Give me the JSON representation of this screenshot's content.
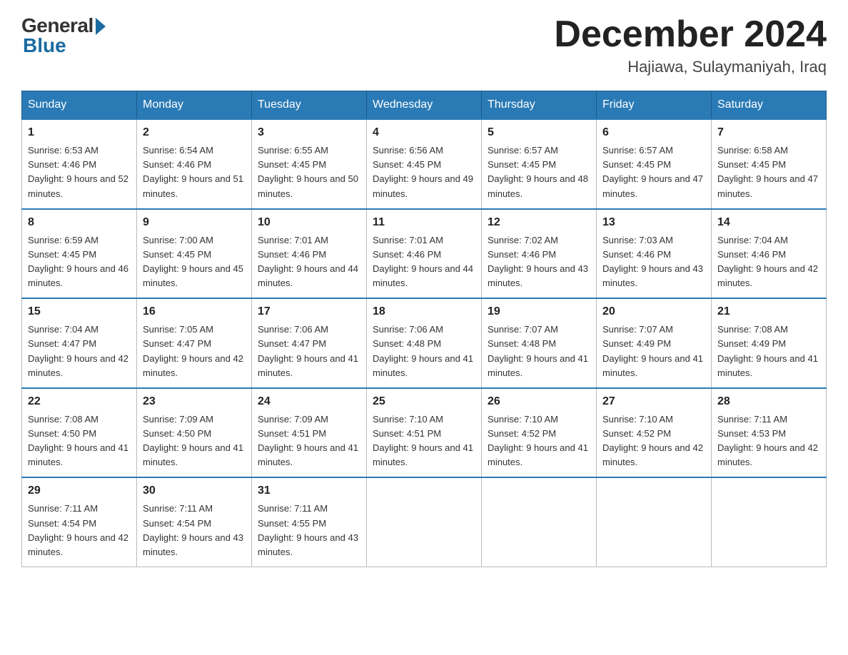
{
  "header": {
    "logo_general": "General",
    "logo_blue": "Blue",
    "month_title": "December 2024",
    "location": "Hajiawa, Sulaymaniyah, Iraq"
  },
  "days_of_week": [
    "Sunday",
    "Monday",
    "Tuesday",
    "Wednesday",
    "Thursday",
    "Friday",
    "Saturday"
  ],
  "weeks": [
    [
      {
        "num": "1",
        "sunrise": "Sunrise: 6:53 AM",
        "sunset": "Sunset: 4:46 PM",
        "daylight": "Daylight: 9 hours and 52 minutes."
      },
      {
        "num": "2",
        "sunrise": "Sunrise: 6:54 AM",
        "sunset": "Sunset: 4:46 PM",
        "daylight": "Daylight: 9 hours and 51 minutes."
      },
      {
        "num": "3",
        "sunrise": "Sunrise: 6:55 AM",
        "sunset": "Sunset: 4:45 PM",
        "daylight": "Daylight: 9 hours and 50 minutes."
      },
      {
        "num": "4",
        "sunrise": "Sunrise: 6:56 AM",
        "sunset": "Sunset: 4:45 PM",
        "daylight": "Daylight: 9 hours and 49 minutes."
      },
      {
        "num": "5",
        "sunrise": "Sunrise: 6:57 AM",
        "sunset": "Sunset: 4:45 PM",
        "daylight": "Daylight: 9 hours and 48 minutes."
      },
      {
        "num": "6",
        "sunrise": "Sunrise: 6:57 AM",
        "sunset": "Sunset: 4:45 PM",
        "daylight": "Daylight: 9 hours and 47 minutes."
      },
      {
        "num": "7",
        "sunrise": "Sunrise: 6:58 AM",
        "sunset": "Sunset: 4:45 PM",
        "daylight": "Daylight: 9 hours and 47 minutes."
      }
    ],
    [
      {
        "num": "8",
        "sunrise": "Sunrise: 6:59 AM",
        "sunset": "Sunset: 4:45 PM",
        "daylight": "Daylight: 9 hours and 46 minutes."
      },
      {
        "num": "9",
        "sunrise": "Sunrise: 7:00 AM",
        "sunset": "Sunset: 4:45 PM",
        "daylight": "Daylight: 9 hours and 45 minutes."
      },
      {
        "num": "10",
        "sunrise": "Sunrise: 7:01 AM",
        "sunset": "Sunset: 4:46 PM",
        "daylight": "Daylight: 9 hours and 44 minutes."
      },
      {
        "num": "11",
        "sunrise": "Sunrise: 7:01 AM",
        "sunset": "Sunset: 4:46 PM",
        "daylight": "Daylight: 9 hours and 44 minutes."
      },
      {
        "num": "12",
        "sunrise": "Sunrise: 7:02 AM",
        "sunset": "Sunset: 4:46 PM",
        "daylight": "Daylight: 9 hours and 43 minutes."
      },
      {
        "num": "13",
        "sunrise": "Sunrise: 7:03 AM",
        "sunset": "Sunset: 4:46 PM",
        "daylight": "Daylight: 9 hours and 43 minutes."
      },
      {
        "num": "14",
        "sunrise": "Sunrise: 7:04 AM",
        "sunset": "Sunset: 4:46 PM",
        "daylight": "Daylight: 9 hours and 42 minutes."
      }
    ],
    [
      {
        "num": "15",
        "sunrise": "Sunrise: 7:04 AM",
        "sunset": "Sunset: 4:47 PM",
        "daylight": "Daylight: 9 hours and 42 minutes."
      },
      {
        "num": "16",
        "sunrise": "Sunrise: 7:05 AM",
        "sunset": "Sunset: 4:47 PM",
        "daylight": "Daylight: 9 hours and 42 minutes."
      },
      {
        "num": "17",
        "sunrise": "Sunrise: 7:06 AM",
        "sunset": "Sunset: 4:47 PM",
        "daylight": "Daylight: 9 hours and 41 minutes."
      },
      {
        "num": "18",
        "sunrise": "Sunrise: 7:06 AM",
        "sunset": "Sunset: 4:48 PM",
        "daylight": "Daylight: 9 hours and 41 minutes."
      },
      {
        "num": "19",
        "sunrise": "Sunrise: 7:07 AM",
        "sunset": "Sunset: 4:48 PM",
        "daylight": "Daylight: 9 hours and 41 minutes."
      },
      {
        "num": "20",
        "sunrise": "Sunrise: 7:07 AM",
        "sunset": "Sunset: 4:49 PM",
        "daylight": "Daylight: 9 hours and 41 minutes."
      },
      {
        "num": "21",
        "sunrise": "Sunrise: 7:08 AM",
        "sunset": "Sunset: 4:49 PM",
        "daylight": "Daylight: 9 hours and 41 minutes."
      }
    ],
    [
      {
        "num": "22",
        "sunrise": "Sunrise: 7:08 AM",
        "sunset": "Sunset: 4:50 PM",
        "daylight": "Daylight: 9 hours and 41 minutes."
      },
      {
        "num": "23",
        "sunrise": "Sunrise: 7:09 AM",
        "sunset": "Sunset: 4:50 PM",
        "daylight": "Daylight: 9 hours and 41 minutes."
      },
      {
        "num": "24",
        "sunrise": "Sunrise: 7:09 AM",
        "sunset": "Sunset: 4:51 PM",
        "daylight": "Daylight: 9 hours and 41 minutes."
      },
      {
        "num": "25",
        "sunrise": "Sunrise: 7:10 AM",
        "sunset": "Sunset: 4:51 PM",
        "daylight": "Daylight: 9 hours and 41 minutes."
      },
      {
        "num": "26",
        "sunrise": "Sunrise: 7:10 AM",
        "sunset": "Sunset: 4:52 PM",
        "daylight": "Daylight: 9 hours and 41 minutes."
      },
      {
        "num": "27",
        "sunrise": "Sunrise: 7:10 AM",
        "sunset": "Sunset: 4:52 PM",
        "daylight": "Daylight: 9 hours and 42 minutes."
      },
      {
        "num": "28",
        "sunrise": "Sunrise: 7:11 AM",
        "sunset": "Sunset: 4:53 PM",
        "daylight": "Daylight: 9 hours and 42 minutes."
      }
    ],
    [
      {
        "num": "29",
        "sunrise": "Sunrise: 7:11 AM",
        "sunset": "Sunset: 4:54 PM",
        "daylight": "Daylight: 9 hours and 42 minutes."
      },
      {
        "num": "30",
        "sunrise": "Sunrise: 7:11 AM",
        "sunset": "Sunset: 4:54 PM",
        "daylight": "Daylight: 9 hours and 43 minutes."
      },
      {
        "num": "31",
        "sunrise": "Sunrise: 7:11 AM",
        "sunset": "Sunset: 4:55 PM",
        "daylight": "Daylight: 9 hours and 43 minutes."
      },
      null,
      null,
      null,
      null
    ]
  ]
}
